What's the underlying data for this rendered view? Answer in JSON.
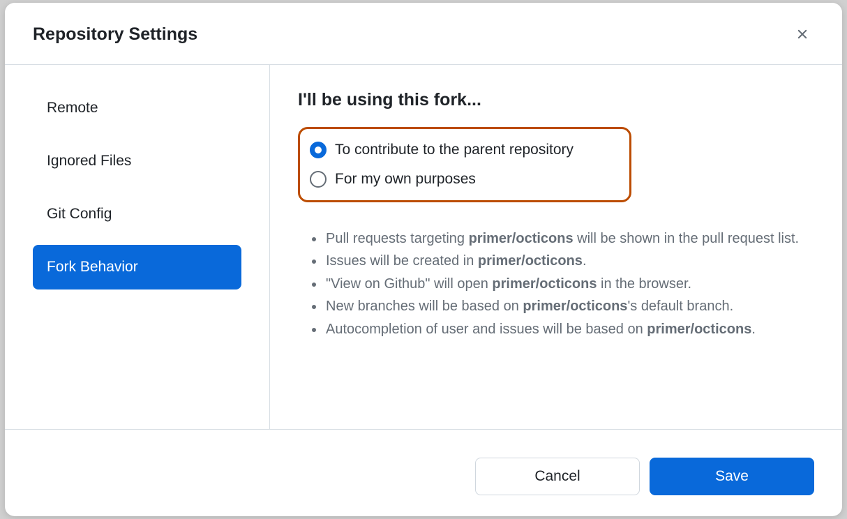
{
  "header": {
    "title": "Repository Settings"
  },
  "sidebar": {
    "items": [
      {
        "label": "Remote",
        "active": false
      },
      {
        "label": "Ignored Files",
        "active": false
      },
      {
        "label": "Git Config",
        "active": false
      },
      {
        "label": "Fork Behavior",
        "active": true
      }
    ]
  },
  "content": {
    "heading": "I'll be using this fork...",
    "options": [
      {
        "label": "To contribute to the parent repository",
        "selected": true
      },
      {
        "label": "For my own purposes",
        "selected": false
      }
    ],
    "repo": "primer/octicons",
    "bullets": {
      "b1_pre": "Pull requests targeting ",
      "b1_post": " will be shown in the pull request list.",
      "b2_pre": "Issues will be created in ",
      "b2_post": ".",
      "b3_pre": "\"View on Github\" will open ",
      "b3_post": " in the browser.",
      "b4_pre": "New branches will be based on ",
      "b4_post": "'s default branch.",
      "b5_pre": "Autocompletion of user and issues will be based on ",
      "b5_post": "."
    }
  },
  "footer": {
    "cancel": "Cancel",
    "save": "Save"
  }
}
